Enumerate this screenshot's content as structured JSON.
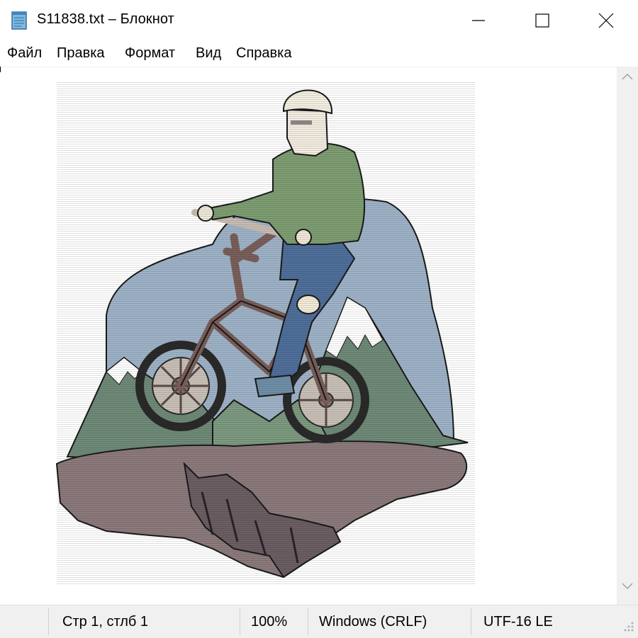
{
  "window": {
    "title": "S11838.txt – Блокнот"
  },
  "menu": [
    "Файл",
    "Правка",
    "Формат",
    "Вид",
    "Справка"
  ],
  "editor": {
    "content_type": "ascii-art illustration"
  },
  "status": {
    "position": "Стр 1, стлб 1",
    "zoom": "100%",
    "line_endings": "Windows (CRLF)",
    "encoding": "UTF-16 LE"
  },
  "colors": {
    "sky": "#9fb3c8",
    "jacket": "#7e9e72",
    "jeans": "#4f6f9a",
    "rock": "#8c7a7c",
    "bike": "#8a6f6a",
    "mountain": "#6f8a78",
    "snow": "#ffffff"
  }
}
